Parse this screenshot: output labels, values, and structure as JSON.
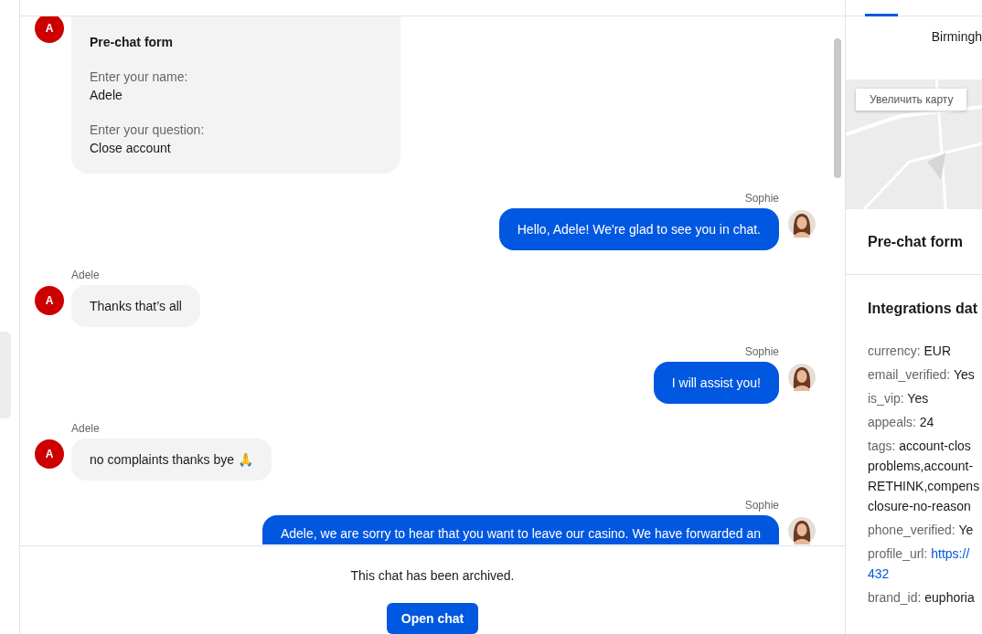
{
  "messages": [
    {
      "kind": "form",
      "avatar": "A",
      "title": "Pre-chat form",
      "fields": [
        {
          "label": "Enter your name:",
          "value": "Adele"
        },
        {
          "label": "Enter your question:",
          "value": "Close account"
        }
      ]
    },
    {
      "kind": "outgoing",
      "sender": "Sophie",
      "text": "Hello, Adele! We're glad to see you in chat."
    },
    {
      "kind": "incoming",
      "sender": "Adele",
      "avatar": "A",
      "text": "Thanks that’s all"
    },
    {
      "kind": "outgoing",
      "sender": "Sophie",
      "text": "I will assist you!"
    },
    {
      "kind": "incoming",
      "sender": "Adele",
      "avatar": "A",
      "text": "no complaints thanks bye 🙏"
    },
    {
      "kind": "outgoing",
      "sender": "Sophie",
      "text": "Adele, we are sorry to hear that you want to leave our casino. We have forwarded an"
    }
  ],
  "footer": {
    "notice": "This chat has been archived.",
    "button": "Open chat"
  },
  "sidebar": {
    "location": "Birmingh",
    "map_button": "Увеличить карту",
    "prechat_title": "Pre-chat form",
    "integrations_title": "Integrations dat",
    "fields": [
      {
        "key": "currency:",
        "value": [
          "EUR"
        ]
      },
      {
        "key": "email_verified:",
        "value": [
          "Yes"
        ]
      },
      {
        "key": "is_vip:",
        "value": [
          "Yes"
        ]
      },
      {
        "key": "appeals:",
        "value": [
          "24"
        ]
      },
      {
        "key": "tags:",
        "value": [
          "account-clos",
          "problems,account-",
          "RETHINK,compens",
          "closure-no-reason"
        ]
      },
      {
        "key": "phone_verified:",
        "value": [
          "Ye"
        ]
      },
      {
        "key": "profile_url:",
        "value": [
          "https://",
          "432"
        ],
        "link": true
      },
      {
        "key": "brand_id:",
        "value": [
          "euphoria"
        ]
      }
    ]
  }
}
